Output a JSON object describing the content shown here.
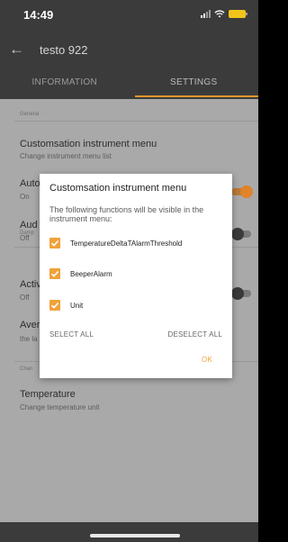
{
  "status_bar": {
    "time": "14:49"
  },
  "app_bar": {
    "title": "testo 922"
  },
  "tabs": [
    {
      "label": "INFORMATION",
      "active": false
    },
    {
      "label": "SETTINGS",
      "active": true
    }
  ],
  "settings": {
    "general_label": "General",
    "customisation_title": "Customsation instrument menu",
    "customisation_sub": "Change instrument menu list",
    "auto_title": "Auto",
    "auto_value": "On",
    "audio_title": "Aud",
    "audio_value": "Off",
    "damping_label": "Damp",
    "active_title": "Activ",
    "active_value": "Off",
    "average_title": "Aver",
    "average_sub": "the la",
    "change_label": "Chan",
    "temperature_title": "Temperature",
    "temperature_sub": "Change temperature unit"
  },
  "dialog": {
    "title": "Customsation instrument menu",
    "message": "The following functions will be visible in the instrument menu:",
    "options": [
      {
        "label": "TemperatureDeltaTAlarmThreshold",
        "checked": true
      },
      {
        "label": "BeeperAlarm",
        "checked": true
      },
      {
        "label": "Unit",
        "checked": true
      }
    ],
    "select_all": "SELECT ALL",
    "deselect_all": "DESELECT ALL",
    "ok": "OK"
  },
  "colors": {
    "accent": "#f0a23a",
    "toolbar": "#3b3b3b",
    "dimmed_background": "#a9a9a9"
  },
  "icons": {
    "back": "arrow-left-icon",
    "signal": "cellular-signal-icon",
    "wifi": "wifi-icon",
    "battery": "battery-charging-icon",
    "checkbox": "checkbox-checked-icon"
  }
}
